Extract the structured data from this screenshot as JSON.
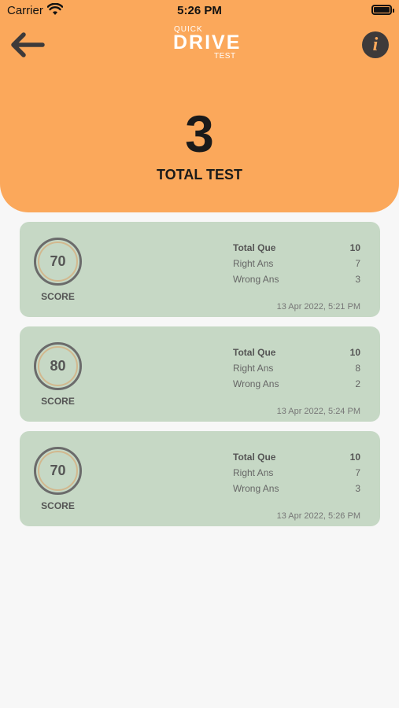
{
  "status": {
    "carrier": "Carrier",
    "time": "5:26 PM"
  },
  "header": {
    "logo": {
      "quick": "QUICK",
      "drive": "DRIVE",
      "test": "TEST"
    },
    "info_glyph": "i",
    "total_count": "3",
    "total_label": "TOTAL TEST"
  },
  "icons": {
    "back": "back-arrow-icon",
    "info": "info-icon"
  },
  "colors": {
    "header": "#fba85b",
    "card": "#c6d8c5",
    "background": "#f7f7f7"
  },
  "labels": {
    "score": "SCORE",
    "total_que": "Total Que",
    "right_ans": "Right Ans",
    "wrong_ans": "Wrong Ans"
  },
  "results": [
    {
      "score": "70",
      "total": "10",
      "right": "7",
      "wrong": "3",
      "date": "13 Apr 2022, 5:21 PM"
    },
    {
      "score": "80",
      "total": "10",
      "right": "8",
      "wrong": "2",
      "date": "13 Apr 2022, 5:24 PM"
    },
    {
      "score": "70",
      "total": "10",
      "right": "7",
      "wrong": "3",
      "date": "13 Apr 2022, 5:26 PM"
    }
  ]
}
